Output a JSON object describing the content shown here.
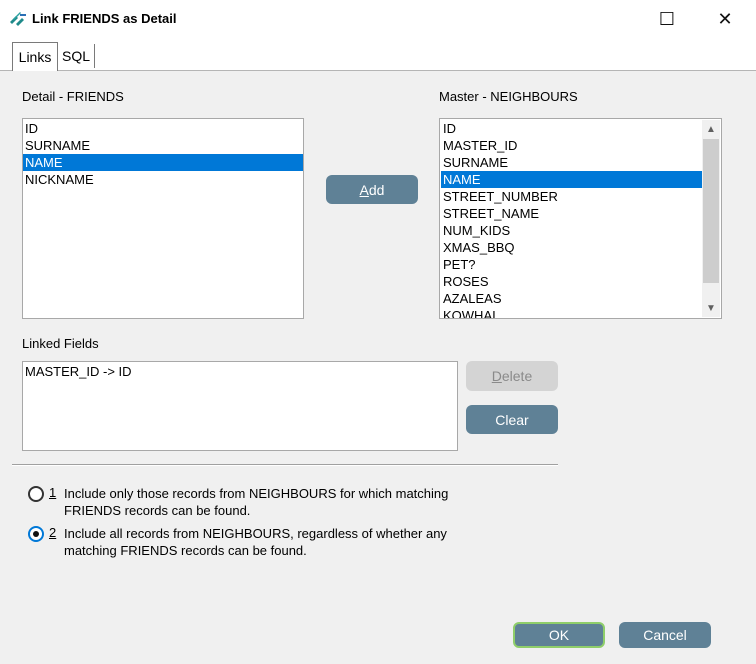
{
  "window": {
    "title": "Link FRIENDS as Detail",
    "maximize_glyph": "☐",
    "close_glyph": "✕",
    "icon": "db-link-icon"
  },
  "tabs": [
    {
      "label": "Links",
      "active": true
    },
    {
      "label": "SQL",
      "active": false
    }
  ],
  "detail": {
    "label": "Detail - FRIENDS",
    "items": [
      "ID",
      "SURNAME",
      "NAME",
      "NICKNAME"
    ],
    "selected": "NAME"
  },
  "master": {
    "label": "Master - NEIGHBOURS",
    "items": [
      "ID",
      "MASTER_ID",
      "SURNAME",
      "NAME",
      "STREET_NUMBER",
      "STREET_NAME",
      "NUM_KIDS",
      "XMAS_BBQ",
      "PET?",
      "ROSES",
      "AZALEAS",
      "KOWHAI"
    ],
    "selected": "NAME"
  },
  "add_button": {
    "mnemonic": "A",
    "rest": "dd"
  },
  "linked": {
    "label": "Linked Fields",
    "items": [
      "MASTER_ID -> ID"
    ]
  },
  "delete_button": {
    "mnemonic": "D",
    "rest": "elete",
    "enabled": false
  },
  "clear_button": {
    "label": "Clear"
  },
  "options": [
    {
      "key": "1",
      "text": "Include only those records from NEIGHBOURS for which matching FRIENDS records can be found.",
      "checked": false
    },
    {
      "key": "2",
      "text": "Include all records from NEIGHBOURS, regardless of whether any matching FRIENDS records can be found.",
      "checked": true
    }
  ],
  "ok_button": {
    "label": "OK"
  },
  "cancel_button": {
    "label": "Cancel"
  },
  "colors": {
    "button": "#5f8196",
    "selection": "#0078d7",
    "default_border": "#8fce6a",
    "disabled_button": "#d4d4d4"
  }
}
